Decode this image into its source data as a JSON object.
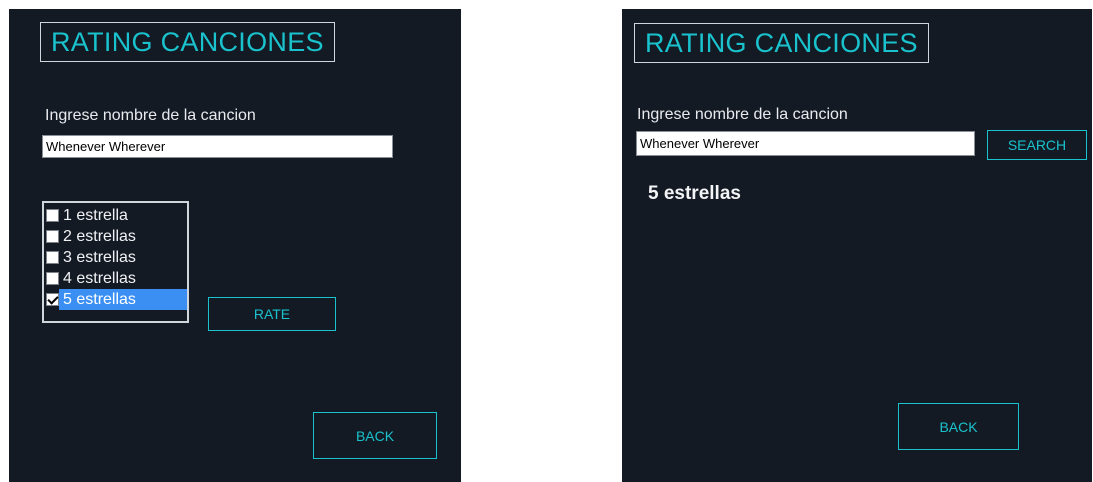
{
  "left": {
    "title": "RATING CANCIONES",
    "prompt_label": "Ingrese nombre de la cancion",
    "song_input": {
      "value": "Whenever Wherever"
    },
    "rating_options": [
      {
        "label": "1 estrella",
        "checked": false,
        "selected": false
      },
      {
        "label": "2 estrellas",
        "checked": false,
        "selected": false
      },
      {
        "label": "3 estrellas",
        "checked": false,
        "selected": false
      },
      {
        "label": "4 estrellas",
        "checked": false,
        "selected": false
      },
      {
        "label": "5 estrellas",
        "checked": true,
        "selected": true
      }
    ],
    "rate_button": "RATE",
    "back_button": "BACK"
  },
  "right": {
    "title": "RATING CANCIONES",
    "prompt_label": "Ingrese nombre de la cancion",
    "song_input": {
      "value": "Whenever Wherever"
    },
    "search_button": "SEARCH",
    "result_text": "5 estrellas",
    "back_button": "BACK"
  },
  "colors": {
    "panel_background": "#141a24",
    "accent": "#19c2cc",
    "selection": "#3b8ff3"
  }
}
